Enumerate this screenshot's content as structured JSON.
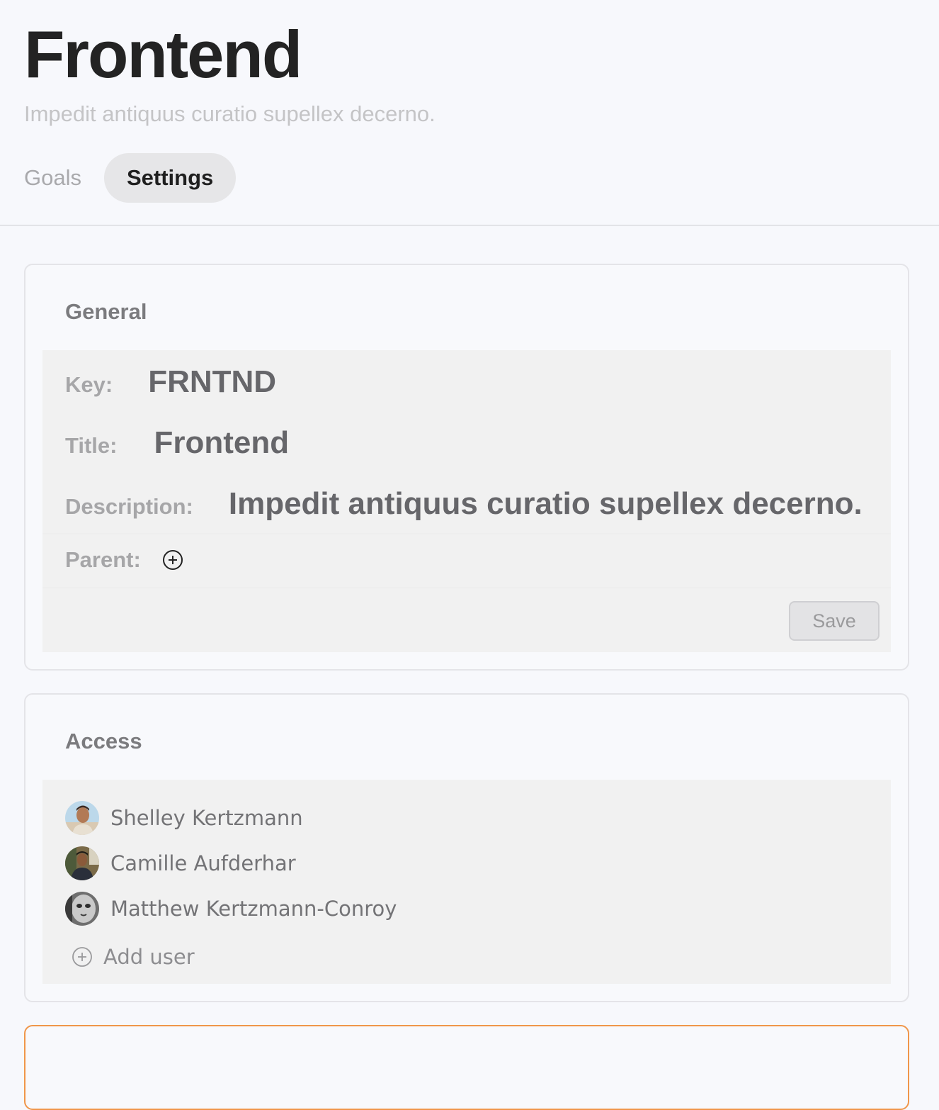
{
  "header": {
    "title": "Frontend",
    "subtitle": "Impedit antiquus curatio supellex decerno.",
    "tabs": [
      {
        "label": "Goals",
        "active": false
      },
      {
        "label": "Settings",
        "active": true
      }
    ]
  },
  "general": {
    "heading": "General",
    "key_label": "Key:",
    "key_value": "FRNTND",
    "title_label": "Title:",
    "title_value": "Frontend",
    "description_label": "Description:",
    "description_value": "Impedit antiquus curatio supellex decerno.",
    "parent_label": "Parent:",
    "parent_icon": "plus-circle-icon",
    "save_label": "Save"
  },
  "access": {
    "heading": "Access",
    "users": [
      {
        "name": "Shelley Kertzmann",
        "avatar": "avatar-photo"
      },
      {
        "name": "Camille Aufderhar",
        "avatar": "avatar-photo"
      },
      {
        "name": "Matthew Kertzmann-Conroy",
        "avatar": "avatar-photo"
      }
    ],
    "add_user_label": "Add user",
    "add_user_icon": "plus-circle-icon"
  },
  "colors": {
    "danger_border": "#f0964a",
    "background": "#f7f8fc",
    "panel": "#f1f1f1"
  }
}
